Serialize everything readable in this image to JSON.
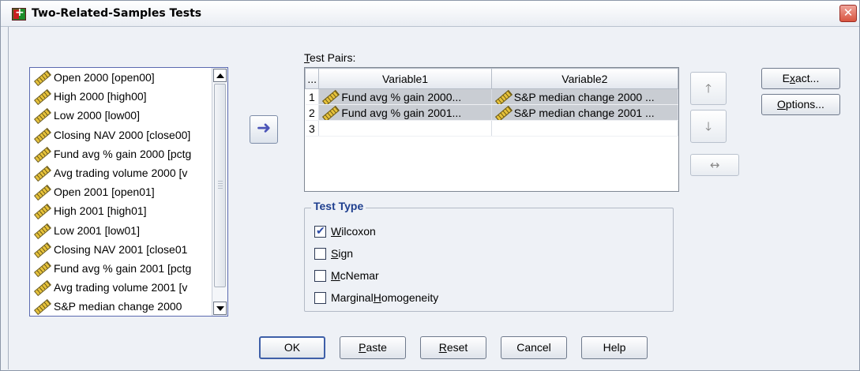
{
  "window": {
    "title": "Two-Related-Samples Tests",
    "close_glyph": "✕"
  },
  "source_list": {
    "items": [
      "Open 2000 [open00]",
      "High 2000 [high00]",
      "Low 2000 [low00]",
      "Closing NAV 2000 [close00]",
      "Fund avg % gain 2000 [pctg",
      "Avg trading volume 2000 [v",
      "Open 2001 [open01]",
      "High 2001 [high01]",
      "Low 2001 [low01]",
      "Closing NAV 2001 [close01",
      "Fund avg % gain 2001 [pctg",
      "Avg trading volume 2001 [v",
      "S&P median change 2000"
    ]
  },
  "move_button": {
    "glyph": "➜"
  },
  "test_pairs": {
    "label_prefix": "T",
    "label_rest": "est Pairs:",
    "columns": [
      "...",
      "Variable1",
      "Variable2"
    ],
    "rows": [
      {
        "num": "1",
        "var1": "Fund avg % gain 2000...",
        "var2": "S&P median change 2000 ...",
        "selected": true
      },
      {
        "num": "2",
        "var1": "Fund avg % gain 2001...",
        "var2": "S&P median change 2001 ...",
        "selected": true
      },
      {
        "num": "3",
        "var1": "",
        "var2": "",
        "selected": false
      }
    ]
  },
  "order_buttons": {
    "up": "🡑",
    "down": "🡓",
    "swap": "↔"
  },
  "side_buttons": {
    "exact": {
      "before": "E",
      "mnemonic": "x",
      "after": "act..."
    },
    "options": {
      "before": "",
      "mnemonic": "O",
      "after": "ptions..."
    }
  },
  "test_type": {
    "legend": "Test Type",
    "options": [
      {
        "before": "",
        "mnemonic": "W",
        "after": "ilcoxon",
        "checked": true
      },
      {
        "before": "",
        "mnemonic": "S",
        "after": "ign",
        "checked": false
      },
      {
        "before": "",
        "mnemonic": "M",
        "after": "cNemar",
        "checked": false
      },
      {
        "before": "Marginal ",
        "mnemonic": "H",
        "after": "omogeneity",
        "checked": false
      }
    ]
  },
  "bottom_buttons": {
    "ok": "OK",
    "paste": {
      "mnemonic": "P",
      "after": "aste"
    },
    "reset": {
      "mnemonic": "R",
      "after": "eset"
    },
    "cancel": "Cancel",
    "help": "Help"
  }
}
